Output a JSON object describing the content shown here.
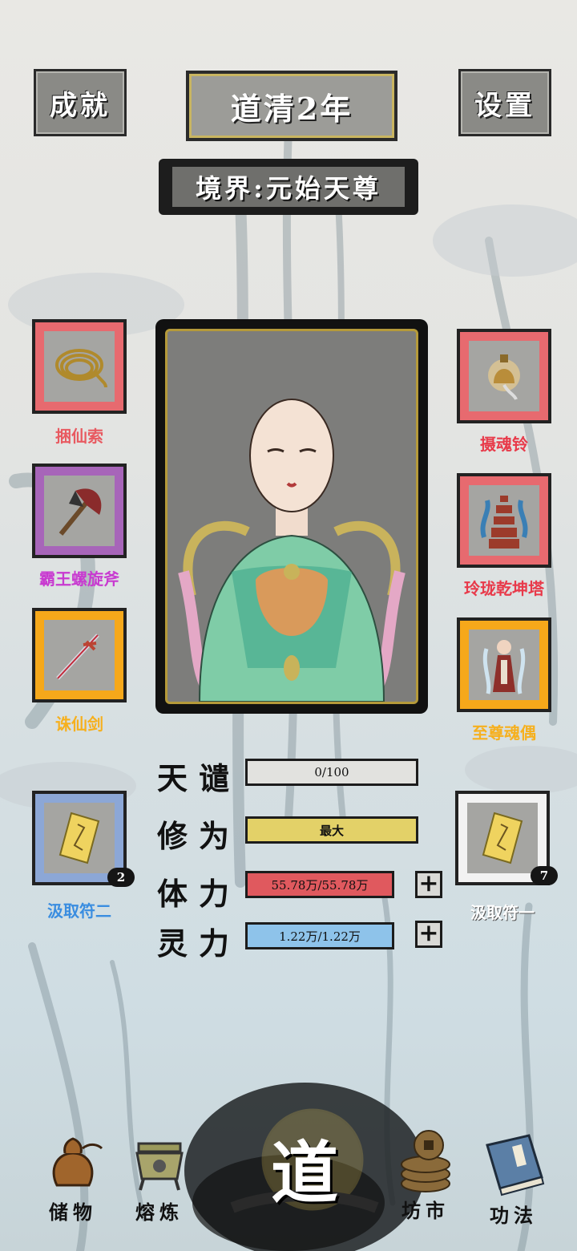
{
  "header": {
    "achievements_label": "成就",
    "year_label": "道清2年",
    "settings_label": "设置",
    "realm_label": "境界:元始天尊"
  },
  "equipment": {
    "left": [
      {
        "name": "捆仙索",
        "icon": "rope-icon",
        "rarity_color": "#e85a61"
      },
      {
        "name": "霸王螺旋斧",
        "icon": "axe-icon",
        "rarity_color": "#c83ad0"
      },
      {
        "name": "诛仙剑",
        "icon": "sword-icon",
        "rarity_color": "#f6b01e"
      }
    ],
    "right": [
      {
        "name": "摄魂铃",
        "icon": "bell-icon",
        "rarity_color": "#e83a4a"
      },
      {
        "name": "玲珑乾坤塔",
        "icon": "pagoda-icon",
        "rarity_color": "#e83a4a"
      },
      {
        "name": "至尊魂偶",
        "icon": "doll-icon",
        "rarity_color": "#f6b01e"
      }
    ]
  },
  "talismans": {
    "left": {
      "name": "汲取符二",
      "count": "2",
      "icon": "talisman-icon",
      "label_color": "#3a8de0"
    },
    "right": {
      "name": "汲取符一",
      "count": "7",
      "icon": "talisman-icon",
      "label_color": "#ffffff"
    }
  },
  "stats": {
    "tianqian": {
      "label": "天谴",
      "value": "0/100",
      "fill": 0.0,
      "color": "#7f7f7d"
    },
    "xiuwei": {
      "label": "修为",
      "value": "最大",
      "fill": 1.0,
      "color": "#e3d168"
    },
    "tili": {
      "label": "体力",
      "value": "55.78万/55.78万",
      "fill": 1.0,
      "color": "#e0595e"
    },
    "lingli": {
      "label": "灵力",
      "value": "1.22万/1.22万",
      "fill": 1.0,
      "color": "#8ec3ea"
    }
  },
  "nav": {
    "storage": "储物",
    "smelting": "熔炼",
    "center": "道",
    "market": "坊市",
    "techniques": "功法"
  }
}
